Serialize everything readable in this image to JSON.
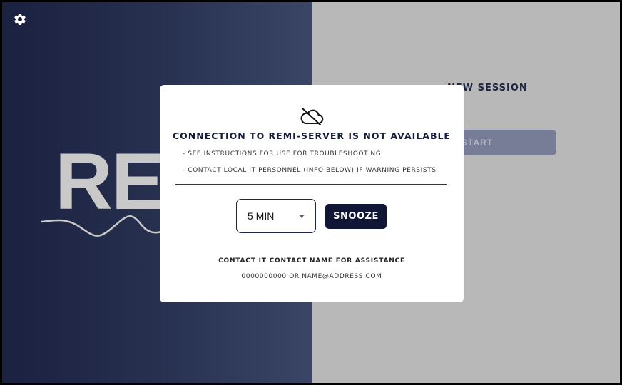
{
  "left_panel": {
    "logo_text": "REMI"
  },
  "right_panel": {
    "session_title": "NEW SESSION",
    "start_button": "START"
  },
  "modal": {
    "title": "CONNECTION TO REMI-SERVER IS NOT AVAILABLE",
    "bullets": [
      "- SEE INSTRUCTIONS FOR USE FOR TROUBLESHOOTING",
      "- CONTACT LOCAL IT PERSONNEL (INFO BELOW) IF WARNING PERSISTS"
    ],
    "snooze_select": {
      "value": "5 MIN"
    },
    "snooze_button": "SNOOZE",
    "contact_title": "CONTACT IT CONTACT NAME FOR ASSISTANCE",
    "contact_info": "0000000000 OR NAME@ADDRESS.COM"
  },
  "icons": {
    "settings": "gear-icon",
    "cloud": "cloud-off-icon",
    "dropdown": "chevron-down-icon"
  },
  "colors": {
    "panel_dark": "#1b2140",
    "panel_gray": "#b8b8b8",
    "button_dark": "#111637",
    "start_button": "#777d97"
  }
}
